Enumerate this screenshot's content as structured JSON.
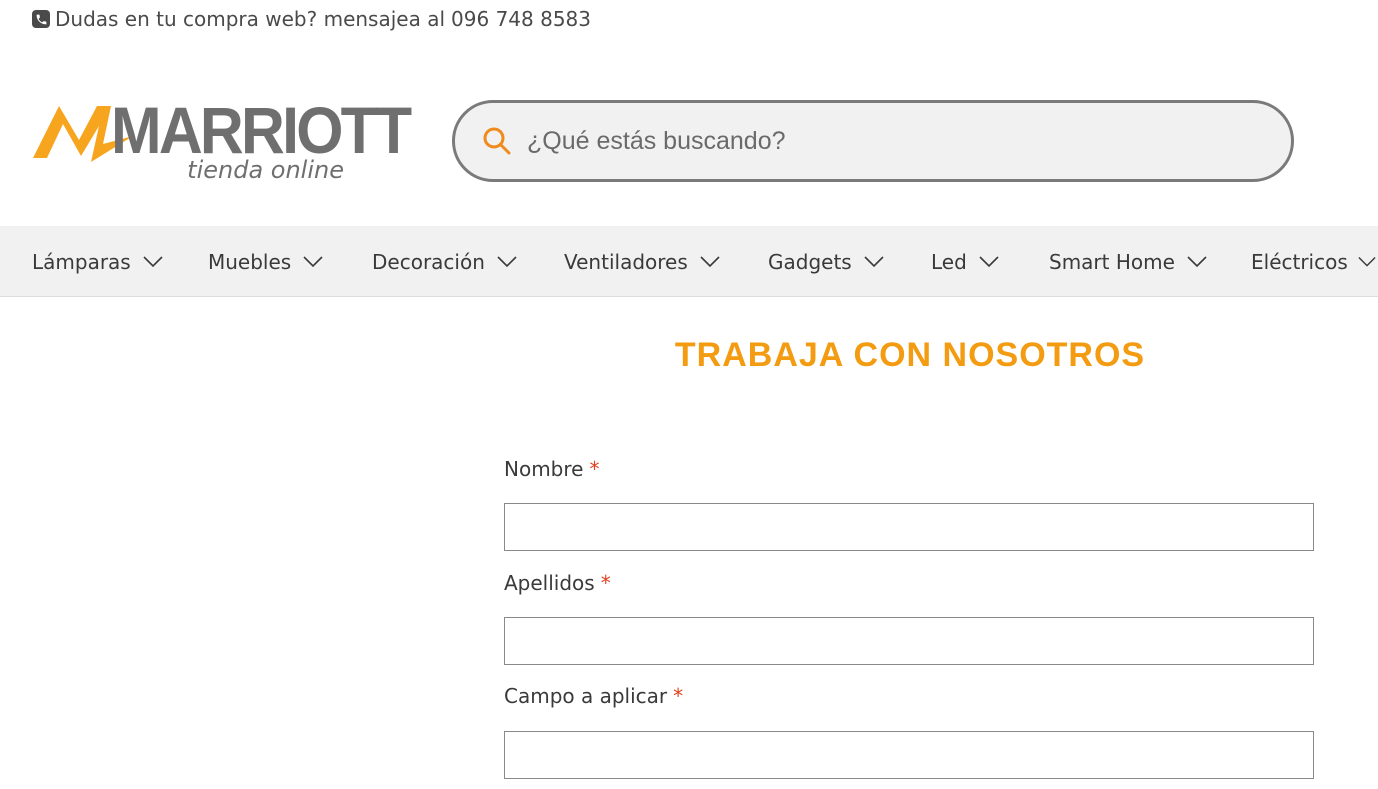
{
  "topbar": {
    "text": "Dudas en tu compra web? mensajea al",
    "phone": "096 748 8583",
    "icon": "phone-icon"
  },
  "logo": {
    "brand": "MARRIOTT",
    "tagline": "tienda online",
    "accent_color": "#f7a51e",
    "gray_color": "#6f6f6f"
  },
  "search": {
    "placeholder": "¿Qué estás buscando?",
    "icon": "search-icon",
    "icon_color": "#f08a1c"
  },
  "nav": {
    "items": [
      {
        "label": "Lámparas"
      },
      {
        "label": "Muebles"
      },
      {
        "label": "Decoración"
      },
      {
        "label": "Ventiladores"
      },
      {
        "label": "Gadgets"
      },
      {
        "label": "Led"
      },
      {
        "label": "Smart Home"
      },
      {
        "label": "Eléctricos"
      }
    ]
  },
  "page": {
    "title": "TRABAJA CON NOSOTROS",
    "title_color": "#f39c12"
  },
  "form": {
    "required_mark": "*",
    "fields": [
      {
        "label": "Nombre",
        "value": ""
      },
      {
        "label": "Apellidos",
        "value": ""
      },
      {
        "label": "Campo a aplicar",
        "value": ""
      }
    ]
  }
}
